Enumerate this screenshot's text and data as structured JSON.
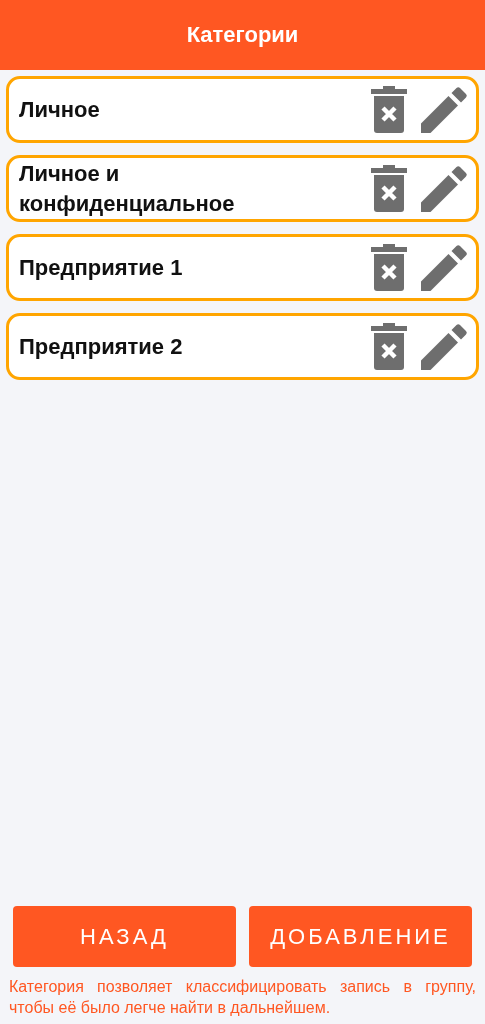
{
  "header": {
    "title": "Категории"
  },
  "categories": [
    {
      "name": "Личное"
    },
    {
      "name": "Личное и конфиденциальное"
    },
    {
      "name": "Предприятие 1"
    },
    {
      "name": "Предприятие 2"
    }
  ],
  "buttons": [
    {
      "label": "НАЗАД"
    },
    {
      "label": "ДОБАВЛЕНИЕ"
    }
  ],
  "hint": "Категория позволяет классифицировать запись в группу, чтобы её было легче найти в дальнейшем."
}
